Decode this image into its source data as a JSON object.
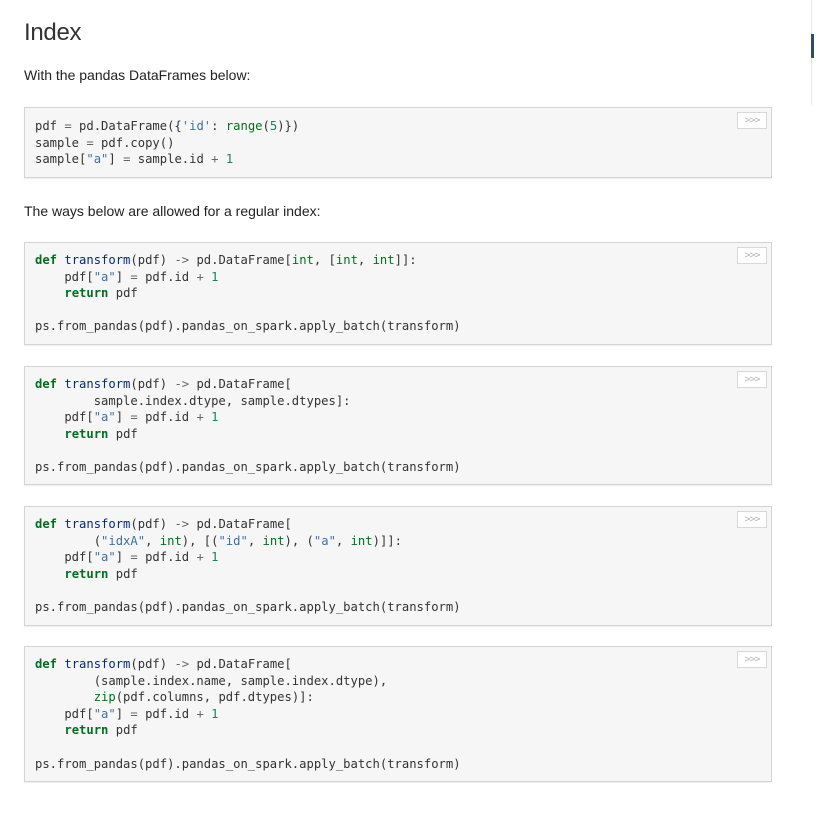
{
  "heading": "Index",
  "paragraphs": {
    "intro": "With the pandas DataFrames below:",
    "allowed": "The ways below are allowed for a regular index:"
  },
  "copy_button_label": ">>>",
  "code_blocks": {
    "setup": [
      "pdf = pd.DataFrame({'id': range(5)})",
      "sample = pdf.copy()",
      "sample[\"a\"] = sample.id + 1"
    ],
    "example1": [
      "def transform(pdf) -> pd.DataFrame[int, [int, int]]:",
      "    pdf[\"a\"] = pdf.id + 1",
      "    return pdf",
      "",
      "ps.from_pandas(pdf).pandas_on_spark.apply_batch(transform)"
    ],
    "example2": [
      "def transform(pdf) -> pd.DataFrame[",
      "        sample.index.dtype, sample.dtypes]:",
      "    pdf[\"a\"] = pdf.id + 1",
      "    return pdf",
      "",
      "ps.from_pandas(pdf).pandas_on_spark.apply_batch(transform)"
    ],
    "example3": [
      "def transform(pdf) -> pd.DataFrame[",
      "        (\"idxA\", int), [(\"id\", int), (\"a\", int)]]:",
      "    pdf[\"a\"] = pdf.id + 1",
      "    return pdf",
      "",
      "ps.from_pandas(pdf).pandas_on_spark.apply_batch(transform)"
    ],
    "example4": [
      "def transform(pdf) -> pd.DataFrame[",
      "        (sample.index.name, sample.index.dtype),",
      "        zip(pdf.columns, pdf.dtypes)]:",
      "    pdf[\"a\"] = pdf.id + 1",
      "    return pdf",
      "",
      "ps.from_pandas(pdf).pandas_on_spark.apply_batch(transform)"
    ]
  },
  "colors": {
    "keyword": "#007020",
    "function_name": "#06287e",
    "string": "#4070a0",
    "number": "#208050",
    "code_background": "#f6f6f6",
    "nav_accent": "#2f4a6b"
  }
}
